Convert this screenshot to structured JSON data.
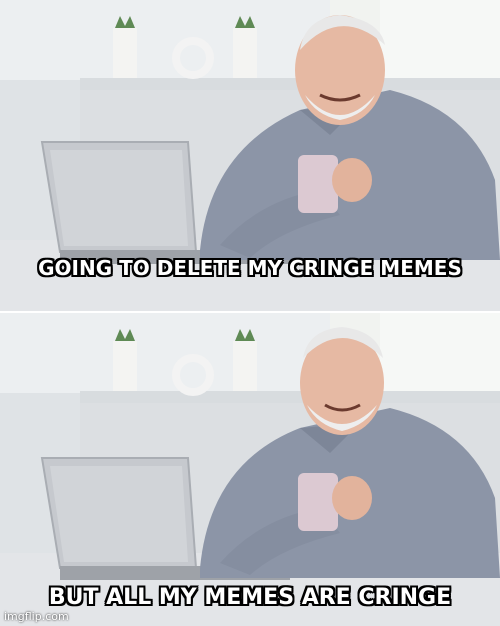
{
  "meme": {
    "template": "Hide the Pain Harold",
    "top_caption": "GOING TO DELETE MY CRINGE MEMES",
    "bottom_caption": "BUT ALL MY MEMES ARE CRINGE",
    "watermark": "imgflip.com"
  },
  "colors": {
    "caption_fill": "#ffffff",
    "caption_stroke": "#000000",
    "wall": "#e9ecee",
    "shirt": "#8a93a5",
    "laptop": "#c9ccd1",
    "mug": "#d9c7d0"
  }
}
